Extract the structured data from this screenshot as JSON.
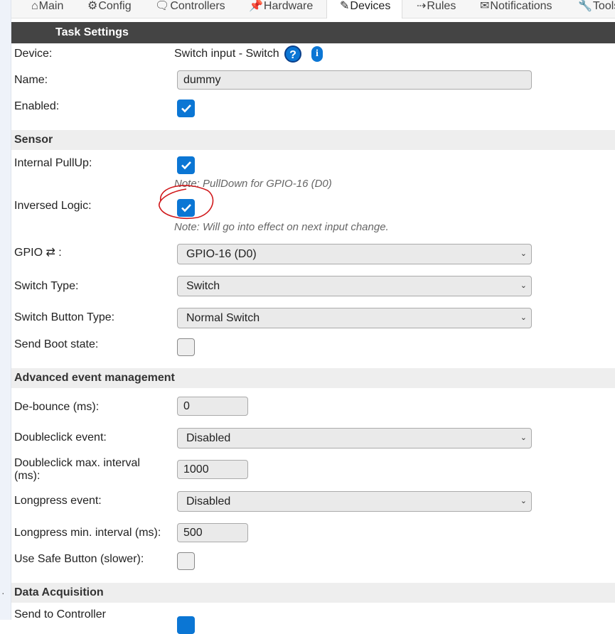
{
  "tabs": [
    {
      "icon": "⌂",
      "label": "Main"
    },
    {
      "icon": "⚙",
      "label": "Config"
    },
    {
      "icon": "🗨",
      "label": "Controllers"
    },
    {
      "icon": "📌",
      "label": "Hardware"
    },
    {
      "icon": "✎",
      "label": "Devices"
    },
    {
      "icon": "⇢",
      "label": "Rules"
    },
    {
      "icon": "✉",
      "label": "Notifications"
    },
    {
      "icon": "🔧",
      "label": "Tools"
    }
  ],
  "active_tab": "Devices",
  "task_settings": {
    "title": "Task Settings",
    "device_label": "Device:",
    "device_value": "Switch input - Switch",
    "help_icon": "?",
    "info_icon": "i",
    "name_label": "Name:",
    "name_value": "dummy",
    "enabled_label": "Enabled:",
    "enabled": true
  },
  "sensor": {
    "title": "Sensor",
    "internal_pullup_label": "Internal PullUp:",
    "internal_pullup": true,
    "pullup_note": "Note: PullDown for GPIO-16 (D0)",
    "inversed_logic_label": "Inversed Logic:",
    "inversed_logic": true,
    "inversed_note": "Note: Will go into effect on next input change.",
    "gpio_label": "GPIO ⇄ :",
    "gpio_value": "GPIO-16 (D0)",
    "switch_type_label": "Switch Type:",
    "switch_type_value": "Switch",
    "switch_button_type_label": "Switch Button Type:",
    "switch_button_type_value": "Normal Switch",
    "send_boot_state_label": "Send Boot state:",
    "send_boot_state": false
  },
  "advanced": {
    "title": "Advanced event management",
    "debounce_label": "De-bounce (ms):",
    "debounce_value": "0",
    "doubleclick_label": "Doubleclick event:",
    "doubleclick_value": "Disabled",
    "doubleclick_interval_label_1": "Doubleclick max. interval",
    "doubleclick_interval_label_2": "(ms):",
    "doubleclick_interval_value": "1000",
    "longpress_label": "Longpress event:",
    "longpress_value": "Disabled",
    "longpress_interval_label": "Longpress min. interval (ms):",
    "longpress_interval_value": "500",
    "safe_button_label": "Use Safe Button (slower):",
    "safe_button": false
  },
  "data_acquisition": {
    "title": "Data Acquisition",
    "send_to_controller_label": "Send to Controller"
  },
  "colors": {
    "accent": "#0b76d4",
    "header_bg": "#444444",
    "section_bg": "#eeeeee",
    "annotation_red": "#d0181b"
  }
}
